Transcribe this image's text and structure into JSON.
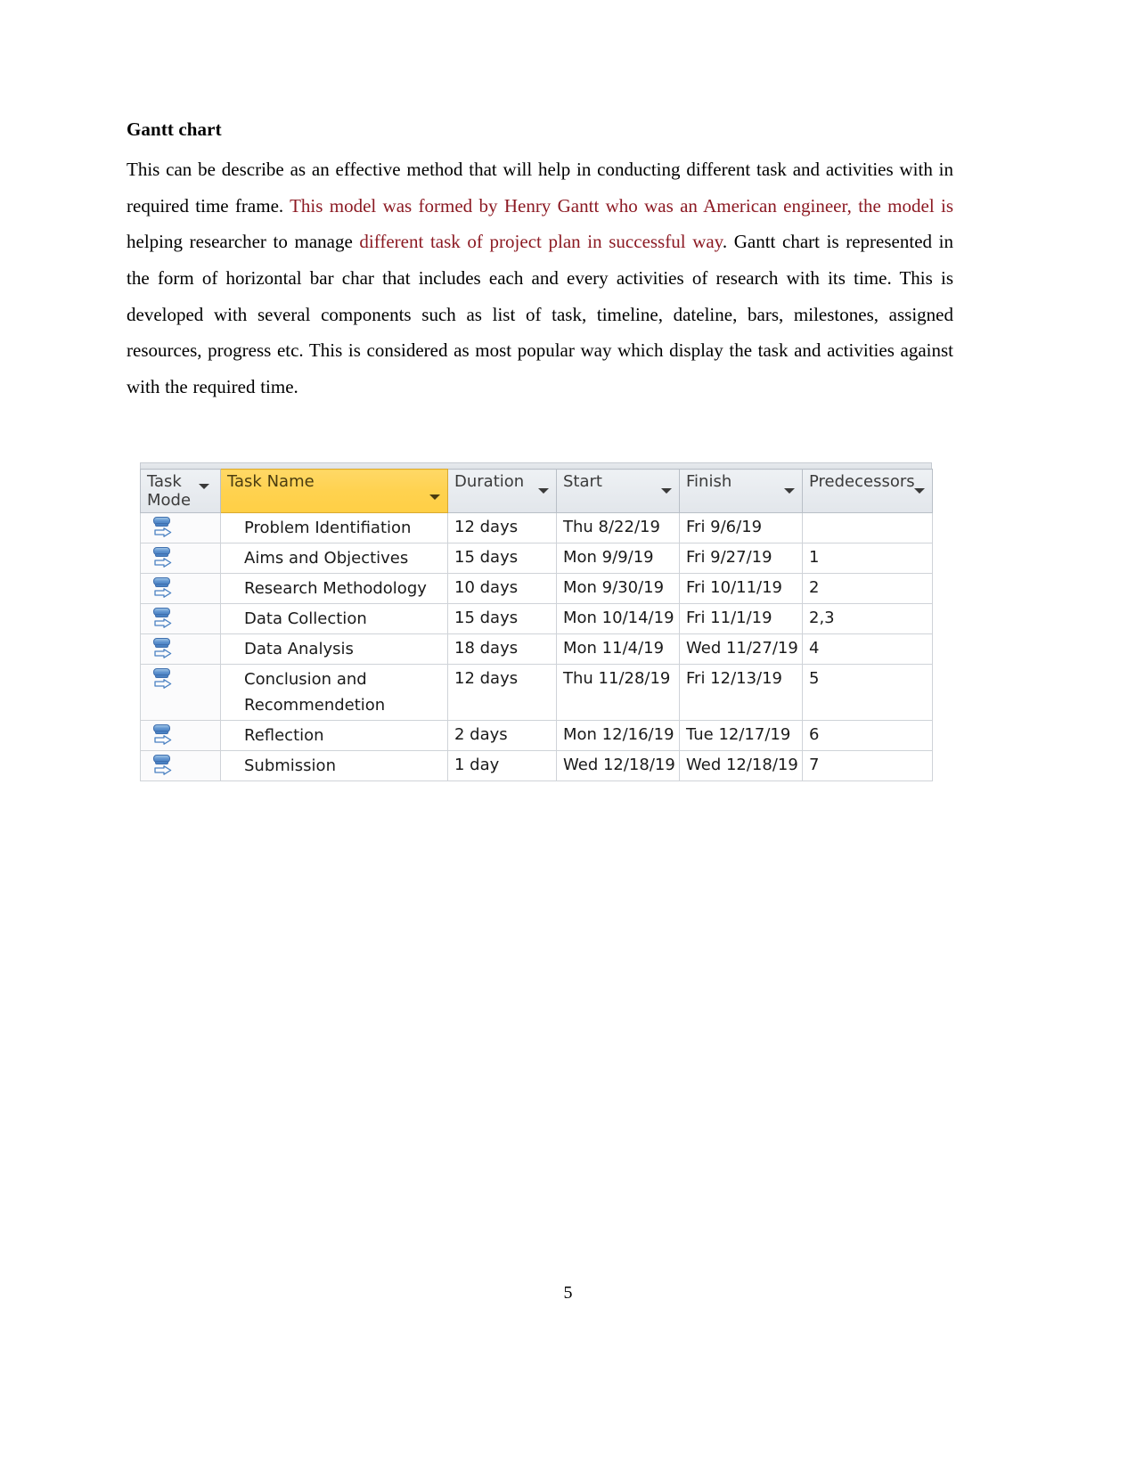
{
  "document": {
    "heading": "Gantt chart",
    "page_number": "5",
    "highlight_color": "#8c1a23",
    "body_color": "#000000",
    "paragraph_runs": [
      {
        "text": "This can be describe as an effective method that will help in conducting different task and activities with in required time frame. ",
        "style": "normal"
      },
      {
        "text": "This model was formed by Henry Gantt who was an American engineer, the model is ",
        "style": "highlight"
      },
      {
        "text": "helping researcher to manage ",
        "style": "normal"
      },
      {
        "text": "different task of project plan in successful way",
        "style": "highlight"
      },
      {
        "text": ".  Gantt chart is represented in the form of horizontal bar char that includes each and every activities of research with its time. This is developed with several components such as list of task, timeline, dateline, bars, milestones, assigned resources, progress etc.   This is considered as most popular way which display the task and activities against with the required time.",
        "style": "normal"
      }
    ]
  },
  "gantt": {
    "columns": [
      {
        "key": "task_mode",
        "label": "Task Mode",
        "selected": false,
        "has_filter": true
      },
      {
        "key": "task_name",
        "label": "Task Name",
        "selected": true,
        "has_filter": true
      },
      {
        "key": "duration",
        "label": "Duration",
        "selected": false,
        "has_filter": true
      },
      {
        "key": "start",
        "label": "Start",
        "selected": false,
        "has_filter": true
      },
      {
        "key": "finish",
        "label": "Finish",
        "selected": false,
        "has_filter": true
      },
      {
        "key": "predecessors",
        "label": "Predecessors",
        "selected": false,
        "has_filter": true
      }
    ],
    "selected_column_color": "#ffd24f",
    "mode_icon_name": "auto-scheduled-icon",
    "rows": [
      {
        "mode_icon": "auto-scheduled-icon",
        "task_name": "Problem Identifiation",
        "duration": "12 days",
        "start": "Thu 8/22/19",
        "finish": "Fri 9/6/19",
        "predecessors": ""
      },
      {
        "mode_icon": "auto-scheduled-icon",
        "task_name": "Aims and Objectives",
        "duration": "15 days",
        "start": "Mon 9/9/19",
        "finish": "Fri 9/27/19",
        "predecessors": "1"
      },
      {
        "mode_icon": "auto-scheduled-icon",
        "task_name": "Research Methodology",
        "duration": "10 days",
        "start": "Mon 9/30/19",
        "finish": "Fri 10/11/19",
        "predecessors": "2"
      },
      {
        "mode_icon": "auto-scheduled-icon",
        "task_name": "Data Collection",
        "duration": "15 days",
        "start": "Mon 10/14/19",
        "finish": "Fri 11/1/19",
        "predecessors": "2,3"
      },
      {
        "mode_icon": "auto-scheduled-icon",
        "task_name": "Data Analysis",
        "duration": "18 days",
        "start": "Mon 11/4/19",
        "finish": "Wed 11/27/19",
        "predecessors": "4"
      },
      {
        "mode_icon": "auto-scheduled-icon",
        "task_name": "Conclusion and Recommendetion",
        "duration": "12 days",
        "start": "Thu 11/28/19",
        "finish": "Fri 12/13/19",
        "predecessors": "5",
        "tall": true
      },
      {
        "mode_icon": "auto-scheduled-icon",
        "task_name": "Reflection",
        "duration": "2 days",
        "start": "Mon 12/16/19",
        "finish": "Tue 12/17/19",
        "predecessors": "6"
      },
      {
        "mode_icon": "auto-scheduled-icon",
        "task_name": "Submission",
        "duration": "1 day",
        "start": "Wed 12/18/19",
        "finish": "Wed 12/18/19",
        "predecessors": "7"
      }
    ]
  },
  "chart_data": {
    "type": "table",
    "title": "Gantt chart task schedule",
    "columns": [
      "Task Mode",
      "Task Name",
      "Duration",
      "Start",
      "Finish",
      "Predecessors"
    ],
    "rows": [
      [
        "Auto Scheduled",
        "Problem Identifiation",
        "12 days",
        "Thu 8/22/19",
        "Fri 9/6/19",
        ""
      ],
      [
        "Auto Scheduled",
        "Aims and Objectives",
        "15 days",
        "Mon 9/9/19",
        "Fri 9/27/19",
        "1"
      ],
      [
        "Auto Scheduled",
        "Research Methodology",
        "10 days",
        "Mon 9/30/19",
        "Fri 10/11/19",
        "2"
      ],
      [
        "Auto Scheduled",
        "Data Collection",
        "15 days",
        "Mon 10/14/19",
        "Fri 11/1/19",
        "2,3"
      ],
      [
        "Auto Scheduled",
        "Data Analysis",
        "18 days",
        "Mon 11/4/19",
        "Wed 11/27/19",
        "4"
      ],
      [
        "Auto Scheduled",
        "Conclusion and Recommendetion",
        "12 days",
        "Thu 11/28/19",
        "Fri 12/13/19",
        "5"
      ],
      [
        "Auto Scheduled",
        "Reflection",
        "2 days",
        "Mon 12/16/19",
        "Tue 12/17/19",
        "6"
      ],
      [
        "Auto Scheduled",
        "Submission",
        "1 day",
        "Wed 12/18/19",
        "Wed 12/18/19",
        "7"
      ]
    ]
  }
}
